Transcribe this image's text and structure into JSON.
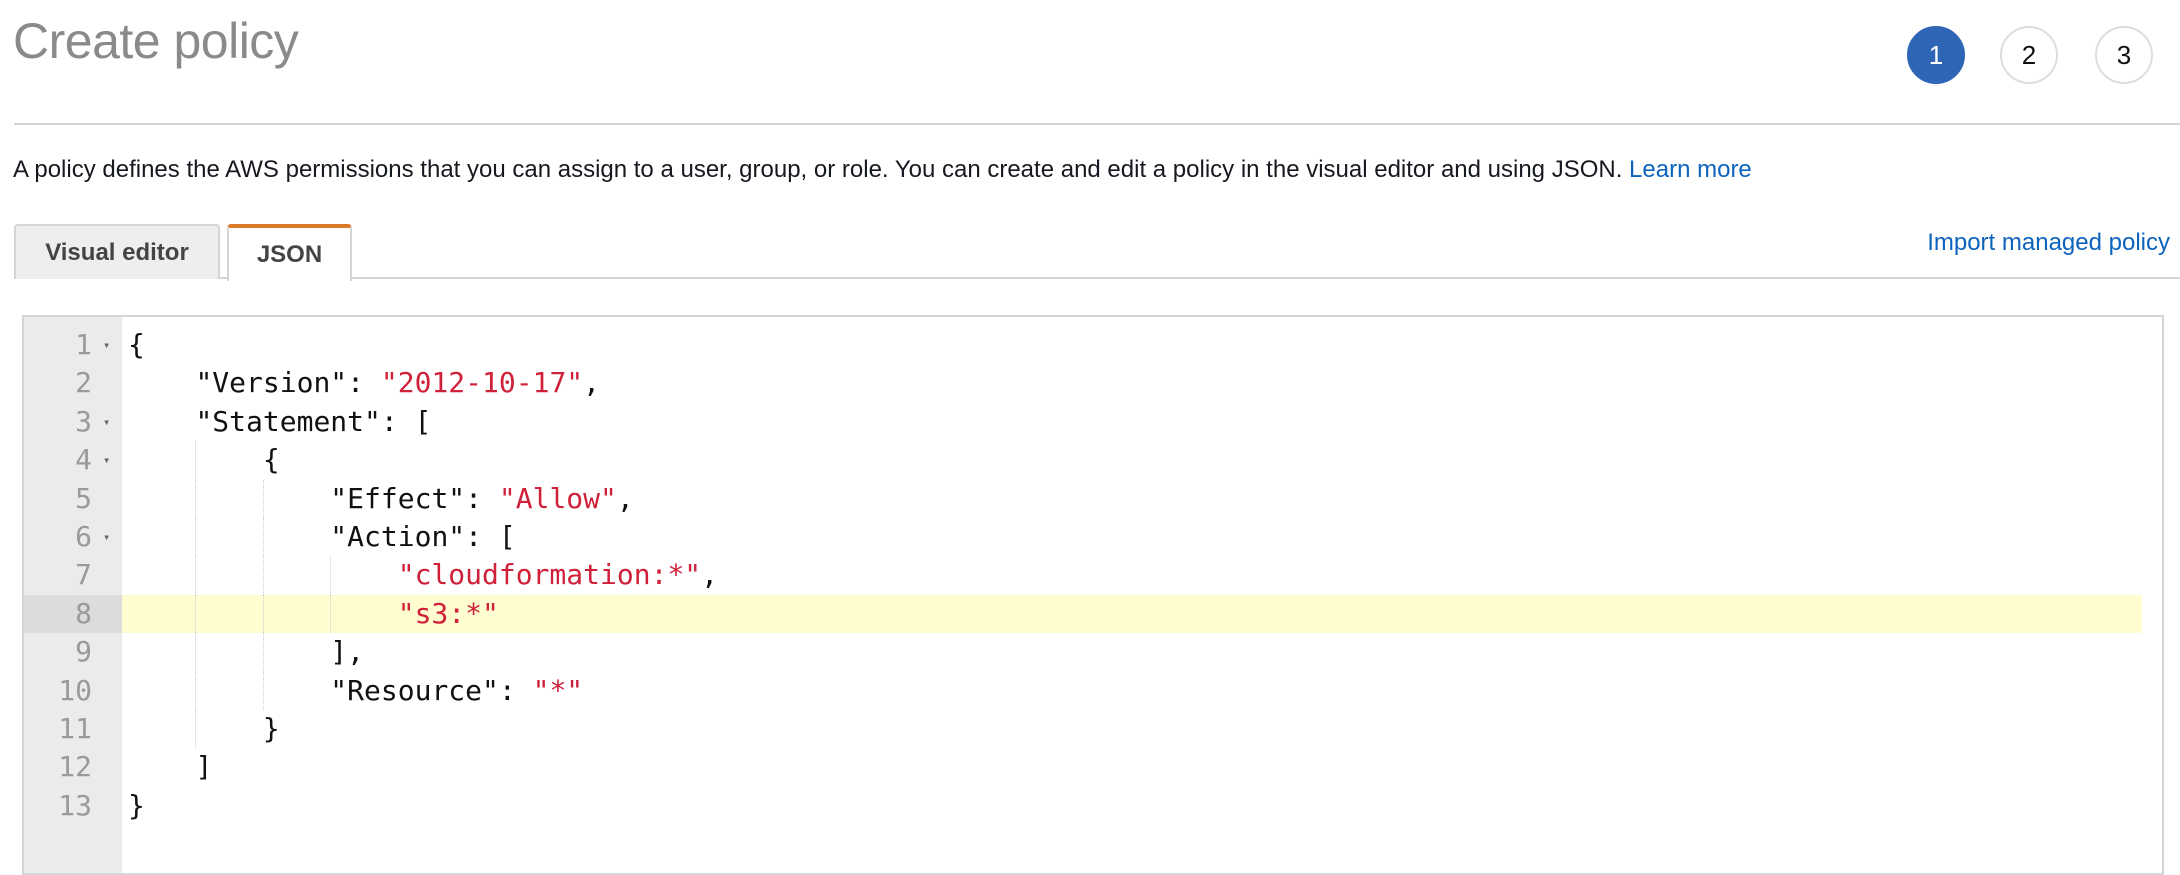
{
  "header": {
    "title": "Create policy",
    "steps": [
      "1",
      "2",
      "3"
    ],
    "active_step": 1
  },
  "description": {
    "text": "A policy defines the AWS permissions that you can assign to a user, group, or role. You can create and edit a policy in the visual editor and using JSON.",
    "learn_more": "Learn more"
  },
  "tabs": [
    {
      "label": "Visual editor",
      "active": false
    },
    {
      "label": "JSON",
      "active": true
    }
  ],
  "import_link": "Import managed policy",
  "colors": {
    "accent": "#2e66b5",
    "tab_active": "#dd7a2a",
    "string": "#d0213a",
    "link": "#0e63bd"
  },
  "editor": {
    "highlighted_line": 8,
    "lines": [
      {
        "num": "1",
        "fold": true,
        "indent": 0,
        "parts": [
          {
            "t": "{"
          }
        ]
      },
      {
        "num": "2",
        "fold": false,
        "indent": 1,
        "parts": [
          {
            "t": "\"Version\": "
          },
          {
            "t": "\"2012-10-17\"",
            "s": true
          },
          {
            "t": ","
          }
        ]
      },
      {
        "num": "3",
        "fold": true,
        "indent": 1,
        "parts": [
          {
            "t": "\"Statement\": ["
          }
        ]
      },
      {
        "num": "4",
        "fold": true,
        "indent": 2,
        "parts": [
          {
            "t": "{"
          }
        ]
      },
      {
        "num": "5",
        "fold": false,
        "indent": 3,
        "parts": [
          {
            "t": "\"Effect\": "
          },
          {
            "t": "\"Allow\"",
            "s": true
          },
          {
            "t": ","
          }
        ]
      },
      {
        "num": "6",
        "fold": true,
        "indent": 3,
        "parts": [
          {
            "t": "\"Action\": ["
          }
        ]
      },
      {
        "num": "7",
        "fold": false,
        "indent": 4,
        "parts": [
          {
            "t": "\"cloudformation:*\"",
            "s": true
          },
          {
            "t": ","
          }
        ]
      },
      {
        "num": "8",
        "fold": false,
        "indent": 4,
        "parts": [
          {
            "t": "\"s3:*\"",
            "s": true
          }
        ]
      },
      {
        "num": "9",
        "fold": false,
        "indent": 3,
        "parts": [
          {
            "t": "],"
          }
        ]
      },
      {
        "num": "10",
        "fold": false,
        "indent": 3,
        "parts": [
          {
            "t": "\"Resource\": "
          },
          {
            "t": "\"*\"",
            "s": true
          }
        ]
      },
      {
        "num": "11",
        "fold": false,
        "indent": 2,
        "parts": [
          {
            "t": "}"
          }
        ]
      },
      {
        "num": "12",
        "fold": false,
        "indent": 1,
        "parts": [
          {
            "t": "]"
          }
        ]
      },
      {
        "num": "13",
        "fold": false,
        "indent": 0,
        "parts": [
          {
            "t": "}"
          }
        ]
      }
    ]
  }
}
